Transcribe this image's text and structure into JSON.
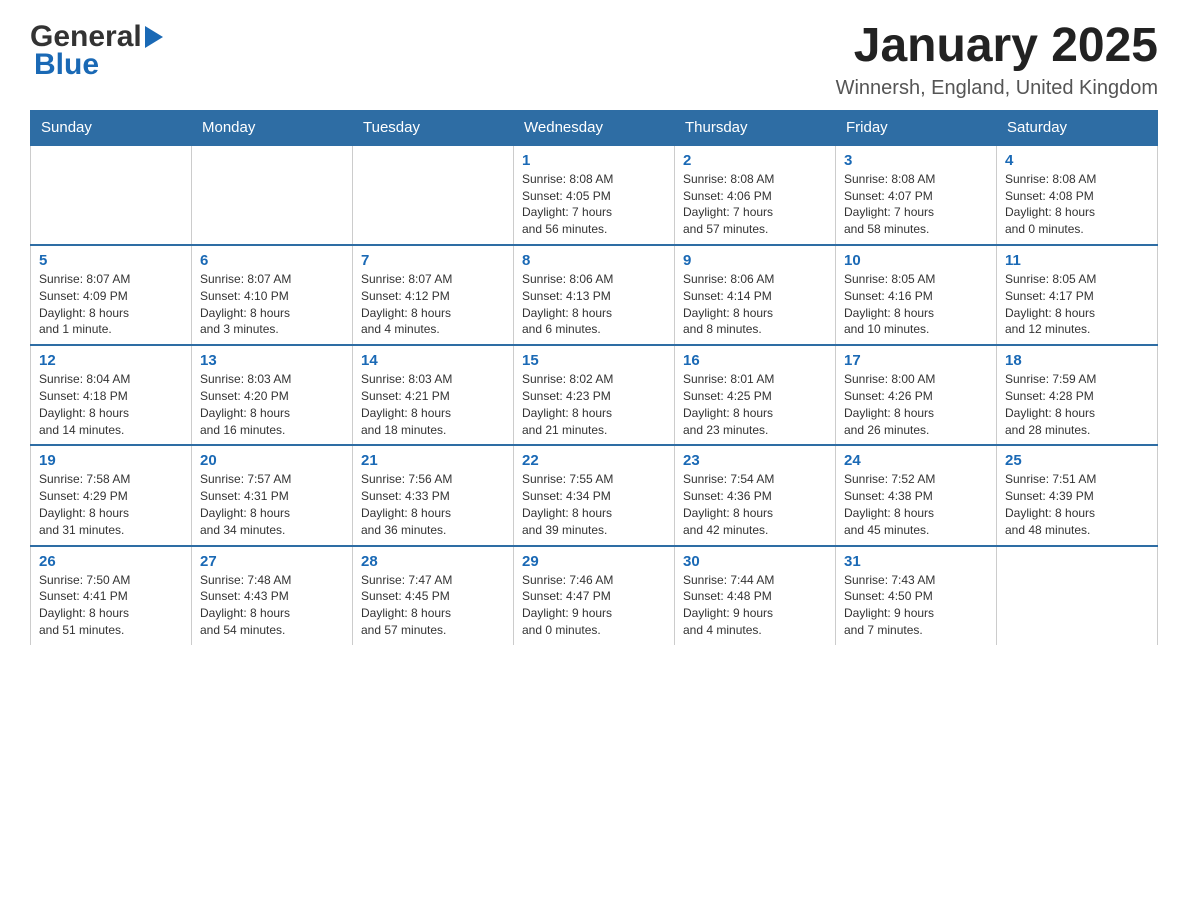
{
  "header": {
    "logo_general": "General",
    "logo_blue": "Blue",
    "title": "January 2025",
    "subtitle": "Winnersh, England, United Kingdom"
  },
  "weekdays": [
    "Sunday",
    "Monday",
    "Tuesday",
    "Wednesday",
    "Thursday",
    "Friday",
    "Saturday"
  ],
  "weeks": [
    [
      {
        "day": "",
        "info": ""
      },
      {
        "day": "",
        "info": ""
      },
      {
        "day": "",
        "info": ""
      },
      {
        "day": "1",
        "info": "Sunrise: 8:08 AM\nSunset: 4:05 PM\nDaylight: 7 hours\nand 56 minutes."
      },
      {
        "day": "2",
        "info": "Sunrise: 8:08 AM\nSunset: 4:06 PM\nDaylight: 7 hours\nand 57 minutes."
      },
      {
        "day": "3",
        "info": "Sunrise: 8:08 AM\nSunset: 4:07 PM\nDaylight: 7 hours\nand 58 minutes."
      },
      {
        "day": "4",
        "info": "Sunrise: 8:08 AM\nSunset: 4:08 PM\nDaylight: 8 hours\nand 0 minutes."
      }
    ],
    [
      {
        "day": "5",
        "info": "Sunrise: 8:07 AM\nSunset: 4:09 PM\nDaylight: 8 hours\nand 1 minute."
      },
      {
        "day": "6",
        "info": "Sunrise: 8:07 AM\nSunset: 4:10 PM\nDaylight: 8 hours\nand 3 minutes."
      },
      {
        "day": "7",
        "info": "Sunrise: 8:07 AM\nSunset: 4:12 PM\nDaylight: 8 hours\nand 4 minutes."
      },
      {
        "day": "8",
        "info": "Sunrise: 8:06 AM\nSunset: 4:13 PM\nDaylight: 8 hours\nand 6 minutes."
      },
      {
        "day": "9",
        "info": "Sunrise: 8:06 AM\nSunset: 4:14 PM\nDaylight: 8 hours\nand 8 minutes."
      },
      {
        "day": "10",
        "info": "Sunrise: 8:05 AM\nSunset: 4:16 PM\nDaylight: 8 hours\nand 10 minutes."
      },
      {
        "day": "11",
        "info": "Sunrise: 8:05 AM\nSunset: 4:17 PM\nDaylight: 8 hours\nand 12 minutes."
      }
    ],
    [
      {
        "day": "12",
        "info": "Sunrise: 8:04 AM\nSunset: 4:18 PM\nDaylight: 8 hours\nand 14 minutes."
      },
      {
        "day": "13",
        "info": "Sunrise: 8:03 AM\nSunset: 4:20 PM\nDaylight: 8 hours\nand 16 minutes."
      },
      {
        "day": "14",
        "info": "Sunrise: 8:03 AM\nSunset: 4:21 PM\nDaylight: 8 hours\nand 18 minutes."
      },
      {
        "day": "15",
        "info": "Sunrise: 8:02 AM\nSunset: 4:23 PM\nDaylight: 8 hours\nand 21 minutes."
      },
      {
        "day": "16",
        "info": "Sunrise: 8:01 AM\nSunset: 4:25 PM\nDaylight: 8 hours\nand 23 minutes."
      },
      {
        "day": "17",
        "info": "Sunrise: 8:00 AM\nSunset: 4:26 PM\nDaylight: 8 hours\nand 26 minutes."
      },
      {
        "day": "18",
        "info": "Sunrise: 7:59 AM\nSunset: 4:28 PM\nDaylight: 8 hours\nand 28 minutes."
      }
    ],
    [
      {
        "day": "19",
        "info": "Sunrise: 7:58 AM\nSunset: 4:29 PM\nDaylight: 8 hours\nand 31 minutes."
      },
      {
        "day": "20",
        "info": "Sunrise: 7:57 AM\nSunset: 4:31 PM\nDaylight: 8 hours\nand 34 minutes."
      },
      {
        "day": "21",
        "info": "Sunrise: 7:56 AM\nSunset: 4:33 PM\nDaylight: 8 hours\nand 36 minutes."
      },
      {
        "day": "22",
        "info": "Sunrise: 7:55 AM\nSunset: 4:34 PM\nDaylight: 8 hours\nand 39 minutes."
      },
      {
        "day": "23",
        "info": "Sunrise: 7:54 AM\nSunset: 4:36 PM\nDaylight: 8 hours\nand 42 minutes."
      },
      {
        "day": "24",
        "info": "Sunrise: 7:52 AM\nSunset: 4:38 PM\nDaylight: 8 hours\nand 45 minutes."
      },
      {
        "day": "25",
        "info": "Sunrise: 7:51 AM\nSunset: 4:39 PM\nDaylight: 8 hours\nand 48 minutes."
      }
    ],
    [
      {
        "day": "26",
        "info": "Sunrise: 7:50 AM\nSunset: 4:41 PM\nDaylight: 8 hours\nand 51 minutes."
      },
      {
        "day": "27",
        "info": "Sunrise: 7:48 AM\nSunset: 4:43 PM\nDaylight: 8 hours\nand 54 minutes."
      },
      {
        "day": "28",
        "info": "Sunrise: 7:47 AM\nSunset: 4:45 PM\nDaylight: 8 hours\nand 57 minutes."
      },
      {
        "day": "29",
        "info": "Sunrise: 7:46 AM\nSunset: 4:47 PM\nDaylight: 9 hours\nand 0 minutes."
      },
      {
        "day": "30",
        "info": "Sunrise: 7:44 AM\nSunset: 4:48 PM\nDaylight: 9 hours\nand 4 minutes."
      },
      {
        "day": "31",
        "info": "Sunrise: 7:43 AM\nSunset: 4:50 PM\nDaylight: 9 hours\nand 7 minutes."
      },
      {
        "day": "",
        "info": ""
      }
    ]
  ]
}
